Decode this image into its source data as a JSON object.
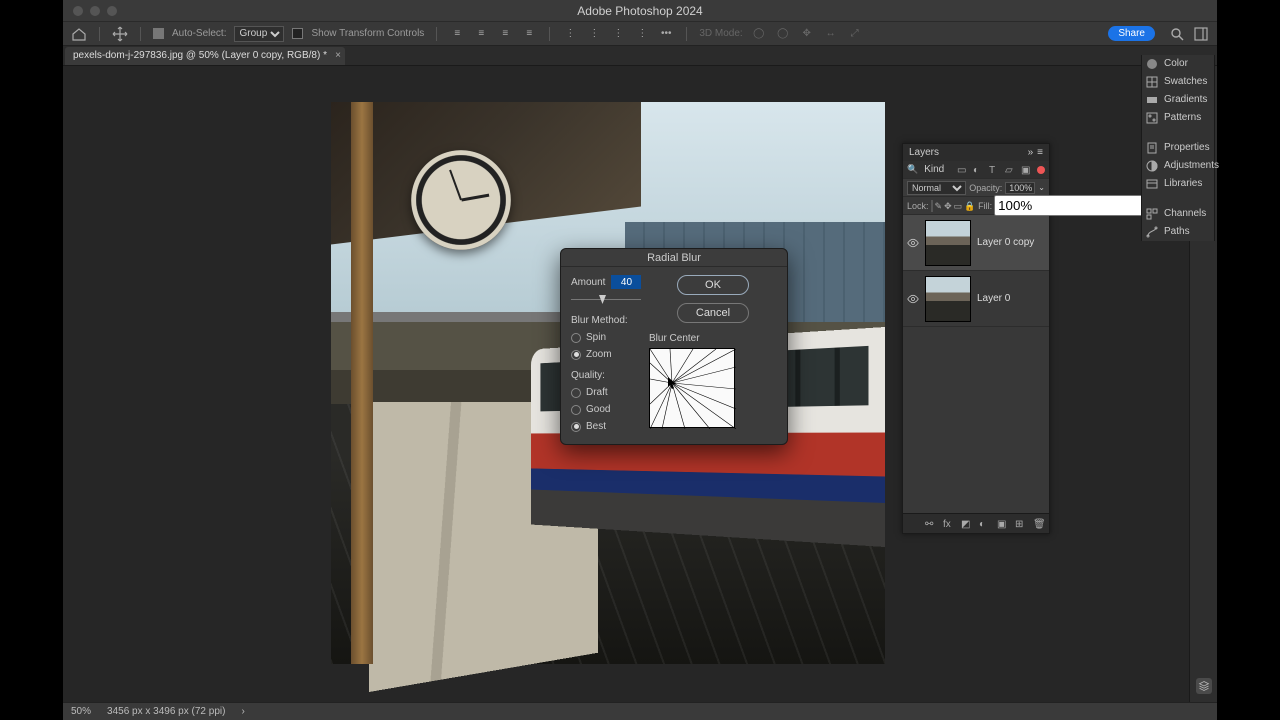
{
  "app": {
    "title": "Adobe Photoshop 2024"
  },
  "optionbar": {
    "auto_select_label": "Auto-Select:",
    "auto_select_value": "Group",
    "show_transform_label": "Show Transform Controls",
    "mode_label": "3D Mode:",
    "share_label": "Share"
  },
  "tab": {
    "name": "pexels-dom-j-297836.jpg @ 50% (Layer 0 copy, RGB/8) *"
  },
  "dialog": {
    "title": "Radial Blur",
    "amount_label": "Amount",
    "amount_value": "40",
    "ok": "OK",
    "cancel": "Cancel",
    "method_label": "Blur Method:",
    "methods": {
      "spin": "Spin",
      "zoom": "Zoom"
    },
    "method_selected": "zoom",
    "quality_label": "Quality:",
    "qualities": {
      "draft": "Draft",
      "good": "Good",
      "best": "Best"
    },
    "quality_selected": "best",
    "center_label": "Blur Center"
  },
  "layers_panel": {
    "title": "Layers",
    "kind_label": "Kind",
    "blend_mode": "Normal",
    "opacity_label": "Opacity:",
    "opacity_value": "100%",
    "lock_label": "Lock:",
    "fill_label": "Fill:",
    "fill_value": "100%",
    "layers": [
      {
        "name": "Layer 0 copy",
        "visible": true,
        "selected": true
      },
      {
        "name": "Layer 0",
        "visible": true,
        "selected": false
      }
    ]
  },
  "side_panels": {
    "items": [
      "Color",
      "Swatches",
      "Gradients",
      "Patterns",
      "Properties",
      "Adjustments",
      "Libraries",
      "Channels",
      "Paths"
    ]
  },
  "statusbar": {
    "zoom": "50%",
    "doc_info": "3456 px x 3496 px (72 ppi)"
  }
}
